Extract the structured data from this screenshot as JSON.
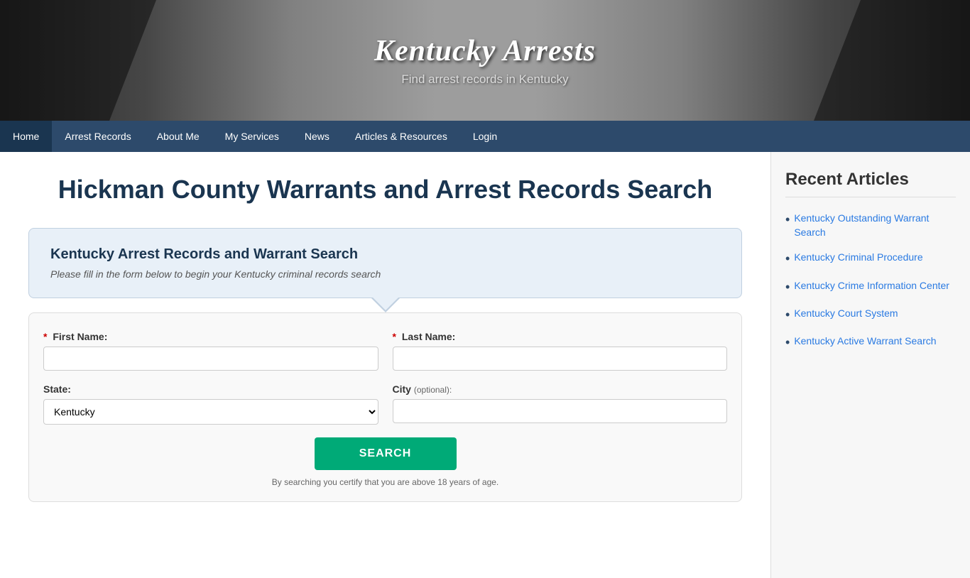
{
  "site": {
    "title": "Kentucky Arrests",
    "subtitle": "Find arrest records in Kentucky"
  },
  "nav": {
    "items": [
      {
        "label": "Home",
        "active": true
      },
      {
        "label": "Arrest Records"
      },
      {
        "label": "About Me"
      },
      {
        "label": "My Services"
      },
      {
        "label": "News"
      },
      {
        "label": "Articles & Resources"
      },
      {
        "label": "Login"
      }
    ]
  },
  "main": {
    "page_title": "Hickman County Warrants and Arrest Records Search",
    "search_box": {
      "title": "Kentucky Arrest Records and Warrant Search",
      "subtitle": "Please fill in the form below to begin your Kentucky criminal records search"
    },
    "form": {
      "first_name_label": "First Name:",
      "last_name_label": "Last Name:",
      "state_label": "State:",
      "city_label": "City",
      "city_optional": "(optional):",
      "state_value": "Kentucky",
      "search_button": "SEARCH",
      "disclaimer": "By searching you certify that you are above 18 years of age."
    }
  },
  "sidebar": {
    "title": "Recent Articles",
    "articles": [
      {
        "label": "Kentucky Outstanding Warrant Search"
      },
      {
        "label": "Kentucky Criminal Procedure"
      },
      {
        "label": "Kentucky Crime Information Center"
      },
      {
        "label": "Kentucky Court System"
      },
      {
        "label": "Kentucky Active Warrant Search"
      }
    ]
  }
}
